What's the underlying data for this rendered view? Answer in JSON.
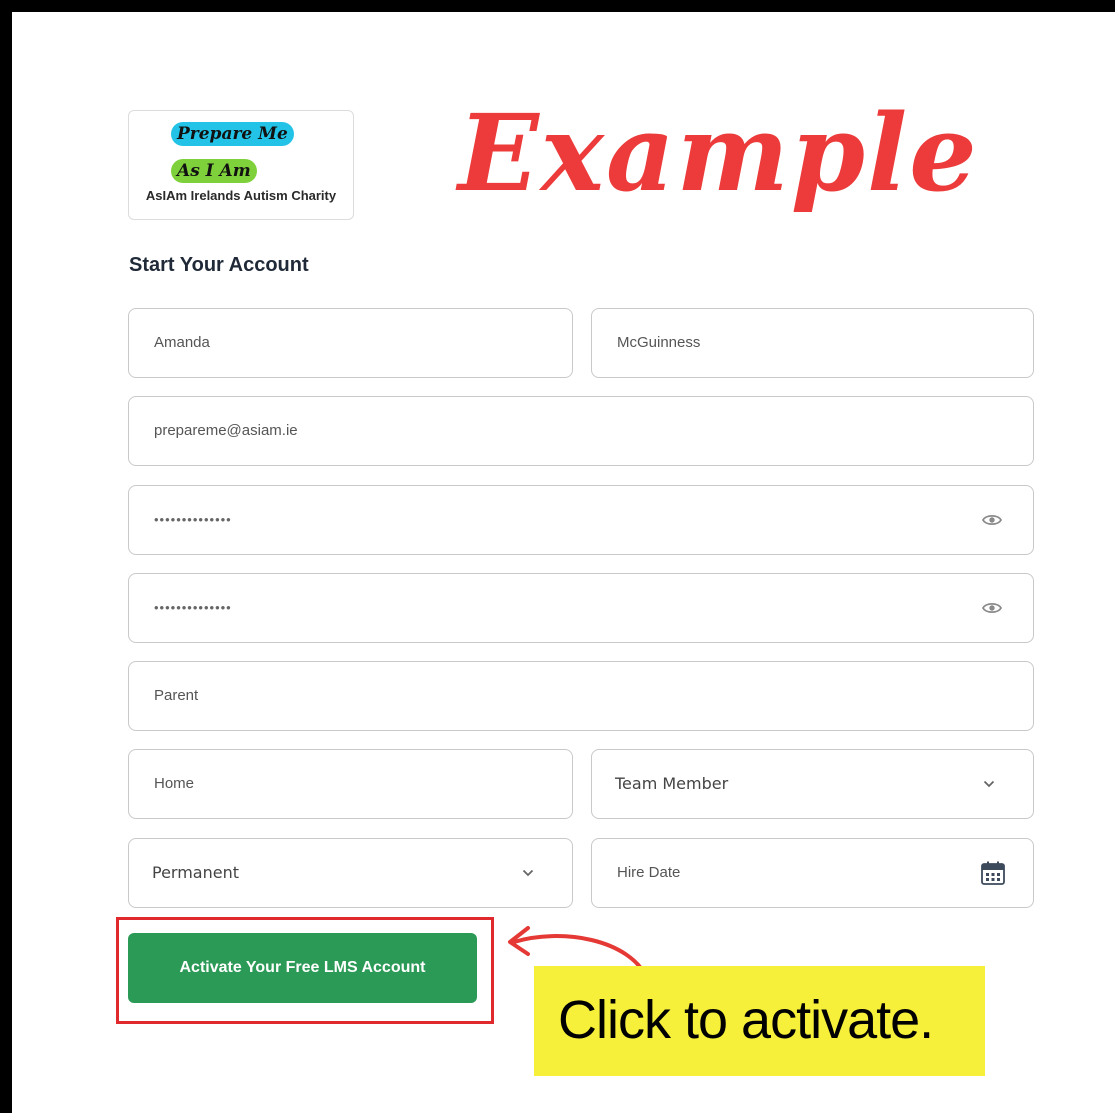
{
  "logo": {
    "line1": "Prepare Me",
    "line2": "As I Am",
    "tagline": "AsIAm Irelands Autism Charity"
  },
  "annotation": {
    "stamp": "Example",
    "callout": "Click to activate.",
    "highlight_color": "#e0292c",
    "callout_bg": "#f6f03a"
  },
  "form": {
    "heading": "Start Your Account",
    "first_name": "Amanda",
    "last_name": "McGuinness",
    "email": "prepareme@asiam.ie",
    "password": "••••••••••••••",
    "confirm_password": "••••••••••••••",
    "role": "Parent",
    "location": "Home",
    "position": "Team Member",
    "employment_type": "Permanent",
    "hire_date_placeholder": "Hire Date",
    "submit_label": "Activate Your Free LMS Account",
    "submit_color": "#2c9a57"
  },
  "icons": {
    "password_toggle": "eye-icon",
    "select_arrow": "chevron-down-icon",
    "date_picker": "calendar-icon"
  }
}
